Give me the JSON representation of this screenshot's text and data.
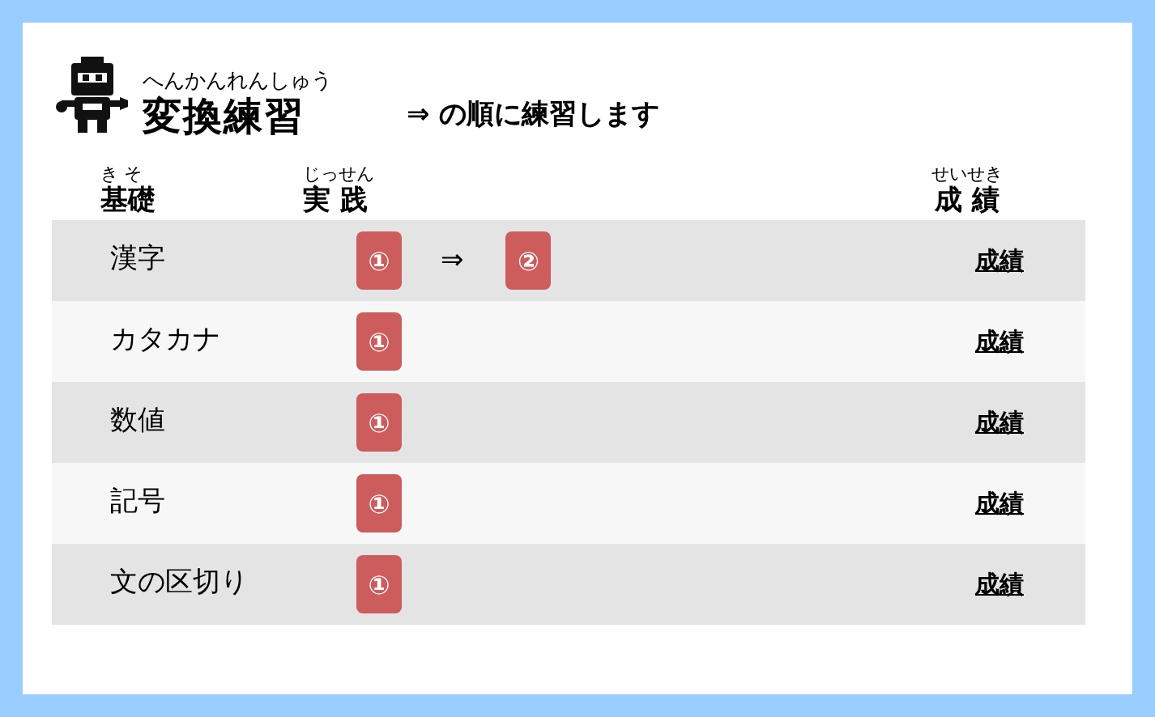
{
  "title": {
    "reading": "へんかんれんしゅう",
    "text": "変換練習"
  },
  "subtitle": "⇒ の順に練習します",
  "columns": [
    {
      "reading": "き そ",
      "text": "基礎"
    },
    {
      "reading": "じっせん",
      "text": "実 践"
    },
    {
      "reading": "せいせき",
      "text": "成 績"
    }
  ],
  "rows": [
    {
      "label": "漢字",
      "steps": [
        "①",
        "②"
      ],
      "connector": "⇒",
      "result": "成績"
    },
    {
      "label": "カタカナ",
      "steps": [
        "①"
      ],
      "result": "成績"
    },
    {
      "label": "数値",
      "steps": [
        "①"
      ],
      "result": "成績"
    },
    {
      "label": "記号",
      "steps": [
        "①"
      ],
      "result": "成績"
    },
    {
      "label": "文の区切り",
      "steps": [
        "①"
      ],
      "result": "成績"
    }
  ]
}
